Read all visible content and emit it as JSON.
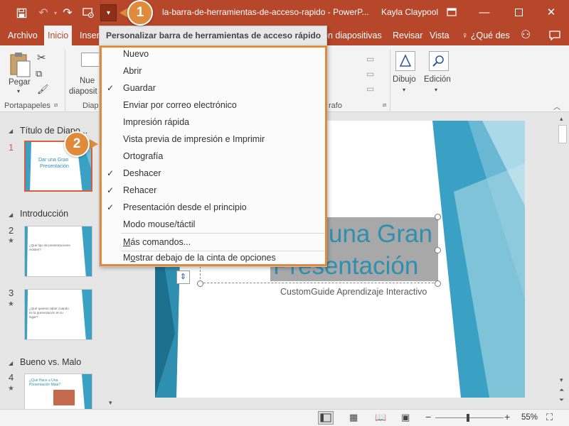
{
  "window": {
    "title": "la-barra-de-herramientas-de-acceso-rapido - PowerP...",
    "user": "Kayla Claypool"
  },
  "tabs": [
    {
      "label": "Archivo"
    },
    {
      "label": "Inicio"
    },
    {
      "label": "Inser"
    },
    {
      "label": "on diapositivas"
    },
    {
      "label": "Revisar"
    },
    {
      "label": "Vista"
    },
    {
      "label": "¿Qué des"
    }
  ],
  "ribbon": {
    "paste_label": "Pegar",
    "new_slide_label_1": "Nue",
    "new_slide_label_2": "diaposit",
    "clipboard_group": "Portapapeles",
    "slides_group_partial": "Diap",
    "paragraph_group_partial": "rafo",
    "drawing_label": "Dibujo",
    "editing_label": "Edición"
  },
  "dropdown": {
    "header": "Personalizar barra de herramientas de acceso rápido",
    "items": [
      {
        "label": "Nuevo",
        "checked": false
      },
      {
        "label": "Abrir",
        "checked": false
      },
      {
        "label": "Guardar",
        "checked": true
      },
      {
        "label": "Enviar por correo electrónico",
        "checked": false
      },
      {
        "label": "Impresión rápida",
        "checked": false
      },
      {
        "label": "Vista previa de impresión e Imprimir",
        "checked": false
      },
      {
        "label": "Ortografía",
        "checked": false
      },
      {
        "label": "Deshacer",
        "checked": true
      },
      {
        "label": "Rehacer",
        "checked": true
      },
      {
        "label": "Presentación desde el principio",
        "checked": true
      },
      {
        "label": "Modo mouse/táctil",
        "checked": false
      }
    ],
    "more_commands": {
      "underlined": "M",
      "rest": "ás comandos..."
    },
    "show_below": {
      "before": "M",
      "underlined": "o",
      "rest": "strar debajo de la cinta de opciones"
    }
  },
  "slide_pane": {
    "sections": [
      {
        "title": "Título de Diapo..."
      },
      {
        "title": "Introducción"
      },
      {
        "title": "Bueno vs. Malo"
      }
    ],
    "slides": [
      {
        "number": "1",
        "text_1": "Dar una Gran",
        "text_2": "Presentación"
      },
      {
        "number": "2",
        "text": "¿Qué tipo de presentaciones existen?"
      },
      {
        "number": "3",
        "text": "¿Qué quieres saber cuando es la presentación en tu lugar?"
      },
      {
        "number": "4",
        "text_1": "¿Qué Hace a Una",
        "text_2": "Presentación Mala?"
      }
    ]
  },
  "slide": {
    "title_line_1": "una Gran",
    "title_line_2": "Presentación",
    "subtitle": "CustomGuide Aprendizaje Interactivo"
  },
  "statusbar": {
    "zoom": "55%"
  },
  "callouts": [
    "1",
    "2"
  ],
  "colors": {
    "accent": "#b7472a",
    "callout": "#e08a3c",
    "slide_teal": "#2e8fb0"
  }
}
